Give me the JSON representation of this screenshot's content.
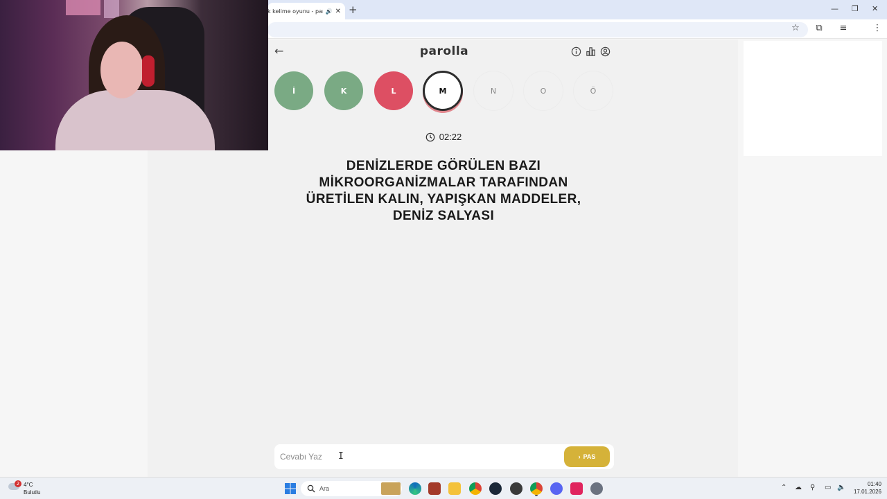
{
  "browser": {
    "tab_title": "k kelime oyunu - parolla",
    "tab_audio_icon": "speaker-icon",
    "tab_close_icon": "close-icon",
    "new_tab_icon": "plus-icon",
    "toolbar_icons": [
      "star-icon",
      "extensions-icon",
      "media-controls-icon",
      "profile-avatar-icon",
      "menu-dots-icon"
    ]
  },
  "header": {
    "logo": "parolla",
    "icons": [
      "info-icon",
      "stats-icon",
      "user-icon"
    ]
  },
  "letters": [
    {
      "char": "İ",
      "state": "correct"
    },
    {
      "char": "K",
      "state": "correct"
    },
    {
      "char": "L",
      "state": "wrong"
    },
    {
      "char": "M",
      "state": "active"
    },
    {
      "char": "N",
      "state": "pending"
    },
    {
      "char": "O",
      "state": "pending"
    },
    {
      "char": "Ö",
      "state": "pending"
    }
  ],
  "colors": {
    "correct": "#7aaa84",
    "wrong": "#dd4f63",
    "pass_button": "#d5b239"
  },
  "timer": {
    "value": "02:22"
  },
  "question": "DENİZLERDE GÖRÜLEN BAZI MİKROORGANİZMALAR TARAFINDAN ÜRETİLEN KALIN, YAPIŞKAN MADDELER, DENİZ SALYASI",
  "answer": {
    "placeholder": "Cevabı Yaz",
    "value": "",
    "pass_label": "PAS"
  },
  "taskbar": {
    "weather_temp": "4°C",
    "weather_desc": "Bulutlu",
    "weather_badge": "2",
    "search_placeholder": "Ara",
    "time": "01:40",
    "date": "17.01.2026"
  }
}
